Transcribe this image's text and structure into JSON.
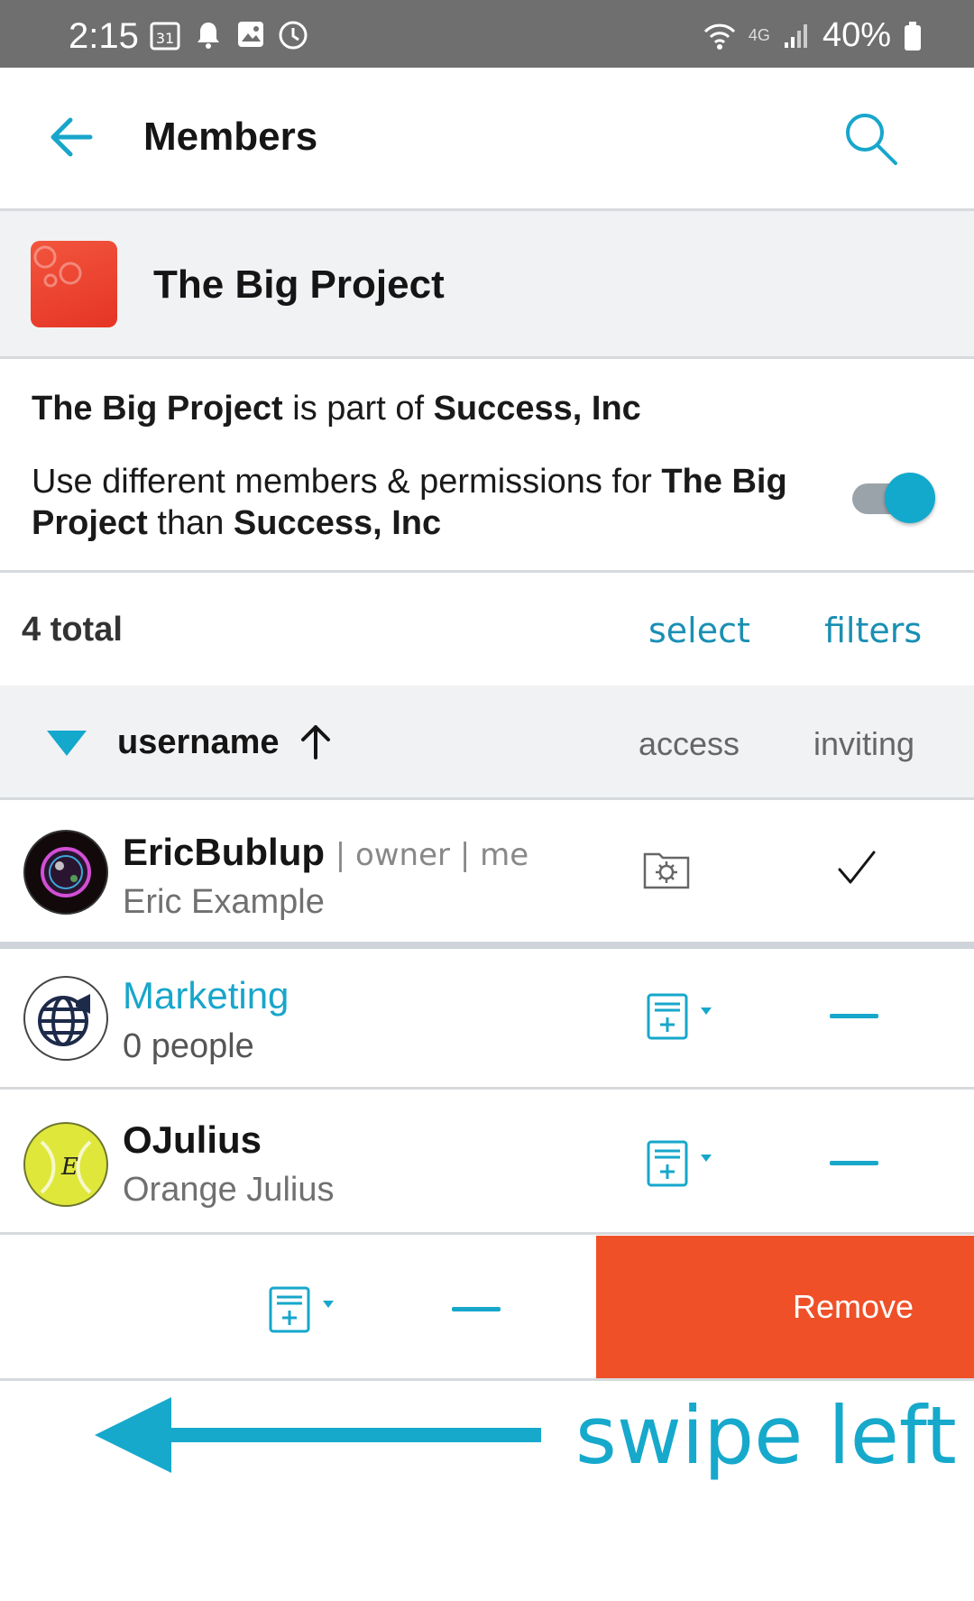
{
  "status_bar": {
    "time": "2:15",
    "battery": "40%",
    "network": "4G",
    "icons": [
      "calendar-icon",
      "bell-icon",
      "image-icon",
      "clock-icon",
      "wifi-icon",
      "signal-icon",
      "battery-icon"
    ]
  },
  "app_bar": {
    "title": "Members",
    "back_icon": "arrow-left-icon",
    "search_icon": "search-icon"
  },
  "project": {
    "name": "The Big Project"
  },
  "info": {
    "part_of_project": "The Big Project",
    "part_of_text": " is part of ",
    "part_of_org": "Success, Inc",
    "different_text": "Use different members & permissions for ",
    "different_project": "The Big Project",
    "than_text": " than ",
    "than_org": "Success, Inc",
    "toggle_on": true
  },
  "list": {
    "total": "4 total",
    "select": "select",
    "filters": "filters",
    "sort_column": "username",
    "col_access": "access",
    "col_inviting": "inviting"
  },
  "members": [
    {
      "username": "EricBublup",
      "tags": "| owner | me",
      "full_name": "Eric Example",
      "access_icon": "folder-gear-icon",
      "inviting": "check"
    },
    {
      "username": "Marketing",
      "full_name": "0 people",
      "access_icon": "add-document-icon",
      "inviting": "dash"
    },
    {
      "username": "OJulius",
      "full_name": "Orange Julius",
      "access_icon": "add-document-icon",
      "inviting": "dash"
    }
  ],
  "swiped_row": {
    "remove_label": "Remove"
  },
  "annotation": {
    "text": "swipe left"
  },
  "colors": {
    "accent": "#16a7cb",
    "remove": "#ef5028",
    "status_bar": "#6f6f6f",
    "header_bg": "#f1f2f4"
  }
}
